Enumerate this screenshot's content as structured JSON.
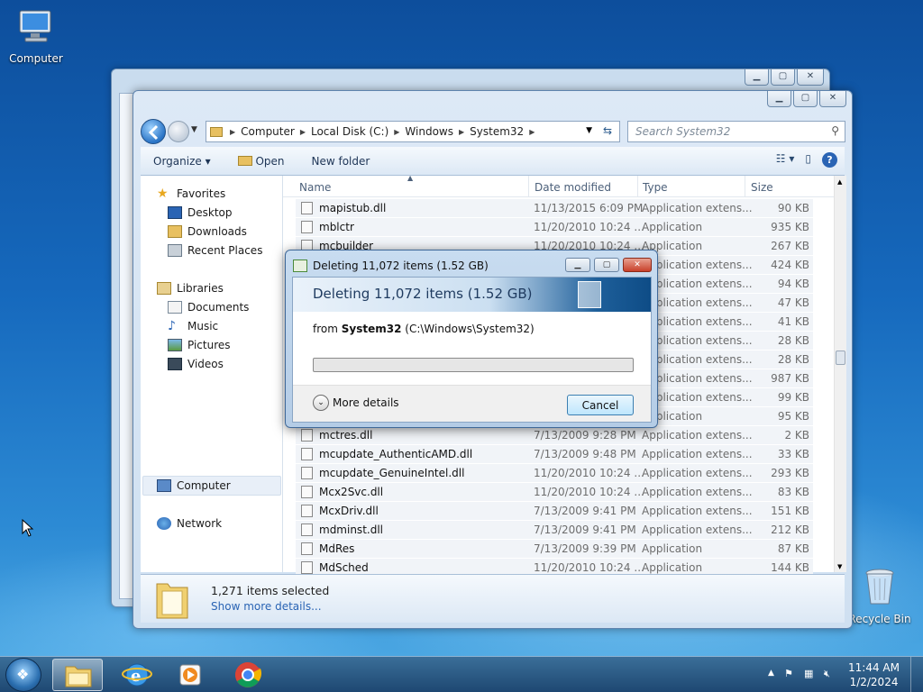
{
  "desktop": {
    "icons": [
      {
        "label": "Computer"
      },
      {
        "label": "Recycle Bin"
      }
    ]
  },
  "explorer": {
    "address": {
      "crumbs": [
        "Computer",
        "Local Disk (C:)",
        "Windows",
        "System32"
      ]
    },
    "search_placeholder": "Search System32",
    "toolbar": {
      "organize": "Organize",
      "open": "Open",
      "new_folder": "New folder"
    },
    "nav": {
      "favorites": "Favorites",
      "desktop": "Desktop",
      "downloads": "Downloads",
      "recent_places": "Recent Places",
      "libraries": "Libraries",
      "documents": "Documents",
      "music": "Music",
      "pictures": "Pictures",
      "videos": "Videos",
      "computer": "Computer",
      "network": "Network"
    },
    "columns": {
      "name": "Name",
      "date": "Date modified",
      "type": "Type",
      "size": "Size"
    },
    "files": [
      {
        "name": "mapistub.dll",
        "date": "11/13/2015 6:09 PM",
        "type": "Application extens...",
        "size": "90 KB"
      },
      {
        "name": "mblctr",
        "date": "11/20/2010 10:24 ...",
        "type": "Application",
        "size": "935 KB"
      },
      {
        "name": "mcbuilder",
        "date": "11/20/2010 10:24 ...",
        "type": "Application",
        "size": "267 KB"
      },
      {
        "name": "",
        "date": "",
        "type": "Application extens...",
        "size": "424 KB"
      },
      {
        "name": "",
        "date": "",
        "type": "Application extens...",
        "size": "94 KB"
      },
      {
        "name": "",
        "date": "",
        "type": "Application extens...",
        "size": "47 KB"
      },
      {
        "name": "",
        "date": "",
        "type": "Application extens...",
        "size": "41 KB"
      },
      {
        "name": "",
        "date": "",
        "type": "Application extens...",
        "size": "28 KB"
      },
      {
        "name": "",
        "date": "",
        "type": "Application extens...",
        "size": "28 KB"
      },
      {
        "name": "",
        "date": "",
        "type": "Application extens...",
        "size": "987 KB"
      },
      {
        "name": "",
        "date": "",
        "type": "Application extens...",
        "size": "99 KB"
      },
      {
        "name": "",
        "date": "",
        "type": "Application",
        "size": "95 KB"
      },
      {
        "name": "mctres.dll",
        "date": "7/13/2009 9:28 PM",
        "type": "Application extens...",
        "size": "2 KB"
      },
      {
        "name": "mcupdate_AuthenticAMD.dll",
        "date": "7/13/2009 9:48 PM",
        "type": "Application extens...",
        "size": "33 KB"
      },
      {
        "name": "mcupdate_GenuineIntel.dll",
        "date": "11/20/2010 10:24 ...",
        "type": "Application extens...",
        "size": "293 KB"
      },
      {
        "name": "Mcx2Svc.dll",
        "date": "11/20/2010 10:24 ...",
        "type": "Application extens...",
        "size": "83 KB"
      },
      {
        "name": "McxDriv.dll",
        "date": "7/13/2009 9:41 PM",
        "type": "Application extens...",
        "size": "151 KB"
      },
      {
        "name": "mdminst.dll",
        "date": "7/13/2009 9:41 PM",
        "type": "Application extens...",
        "size": "212 KB"
      },
      {
        "name": "MdRes",
        "date": "7/13/2009 9:39 PM",
        "type": "Application",
        "size": "87 KB"
      },
      {
        "name": "MdSched",
        "date": "11/20/2010 10:24 ...",
        "type": "Application",
        "size": "144 KB"
      }
    ],
    "details": {
      "selected": "1,271 items selected",
      "more": "Show more details..."
    }
  },
  "dialog": {
    "title": "Deleting 11,072 items (1.52 GB)",
    "heading": "Deleting 11,072 items (1.52 GB)",
    "from_label": "from",
    "from_name": "System32",
    "from_path": "(C:\\Windows\\System32)",
    "progress": 0,
    "more_details": "More details",
    "cancel": "Cancel"
  },
  "taskbar": {
    "time": "11:44 AM",
    "date": "1/2/2024"
  },
  "colors": {
    "accent": "#2a64b4",
    "progress_green": "#2ea82e"
  }
}
